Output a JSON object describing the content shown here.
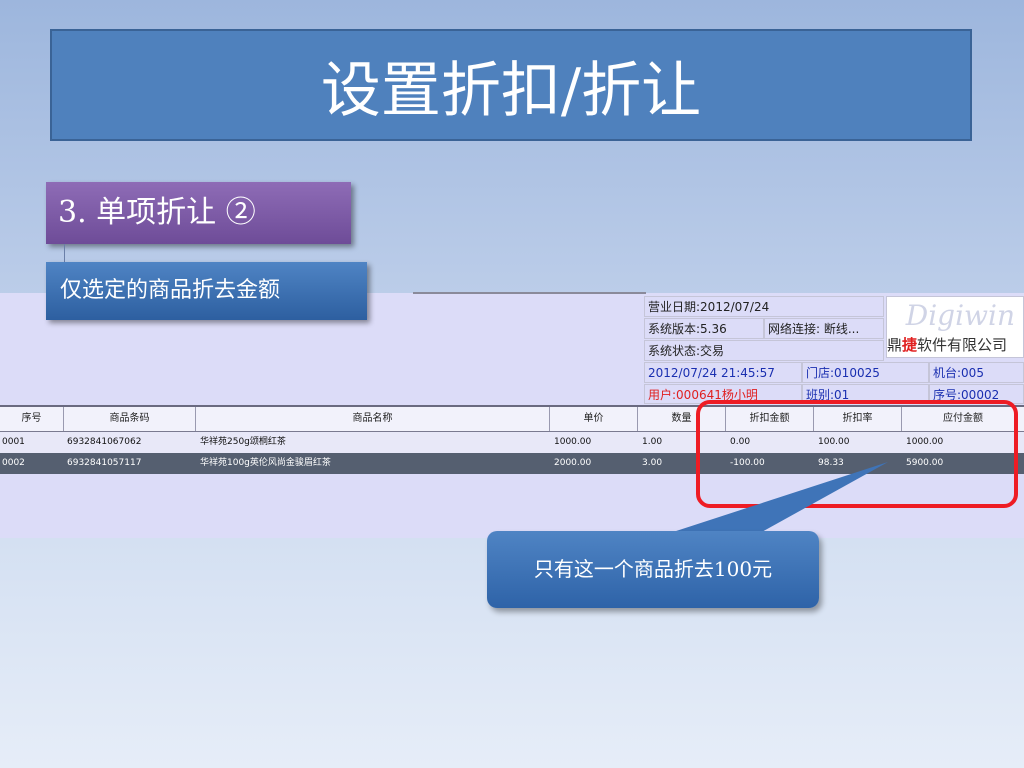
{
  "slide": {
    "title": "设置折扣/折让",
    "section_tag": "3. 单项折让 ②",
    "sub_tag": "仅选定的商品折去金额",
    "callout": "只有这一个商品折去100元"
  },
  "info": {
    "business_date": "营业日期:2012/07/24",
    "version": "系统版本:5.36",
    "network": "网络连接: 断线...",
    "status": "系统状态:交易",
    "datetime": "2012/07/24 21:45:57",
    "store": "门店:010025",
    "machine": "机台:005",
    "user": "用户:000641杨小明",
    "shift": "班别:01",
    "serial": "序号:00002"
  },
  "logo": {
    "script": "Digiwin",
    "cn_pre": "鼎",
    "cn_hl": "捷",
    "cn_post": "软件有限公司"
  },
  "table": {
    "headers": [
      "序号",
      "商品条码",
      "商品名称",
      "单价",
      "数量",
      "折扣金额",
      "折扣率",
      "应付金额"
    ],
    "rows": [
      [
        "0001",
        "6932841067062",
        "华祥苑250g颂桐红茶",
        "1000.00",
        "1.00",
        "0.00",
        "100.00",
        "1000.00"
      ],
      [
        "0002",
        "6932841057117",
        "华祥苑100g英伦风尚金骏眉红茶",
        "2000.00",
        "3.00",
        "-100.00",
        "98.33",
        "5900.00"
      ]
    ]
  },
  "colors": {
    "title_bg": "#4f81bd",
    "section_bg": "#7b5aa6",
    "highlight": "#ee1c24",
    "selected_row": "#555f70"
  }
}
